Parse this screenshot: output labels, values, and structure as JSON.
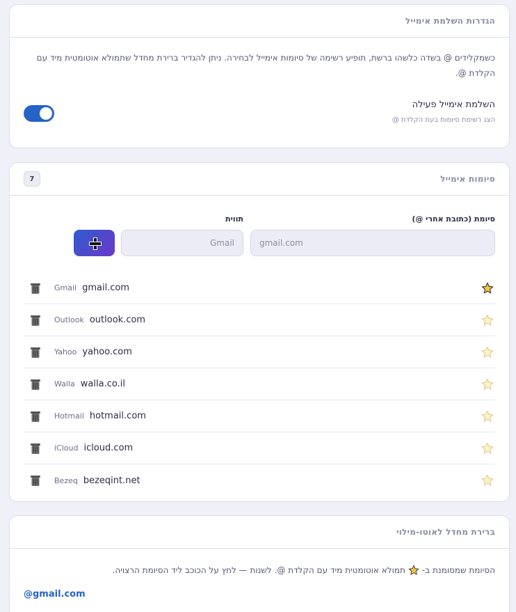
{
  "settings": {
    "title": "הגדרות השלמת אימייל",
    "description": "כשמקלידים @ בשדה כלשהו ברשת, תופיע רשימה של סיומות אימייל לבחירה. ניתן להגדיר ברירת מחדל שתמולא אוטומטית מיד עם הקלדת @.",
    "toggle_label": "השלמת אימייל פעילה",
    "toggle_sub": "הצג רשימת סיומות בעת הקלדת @",
    "toggle_on": true,
    "accent_color": "#2563c7"
  },
  "suffixes": {
    "title": "סיומות אימייל",
    "count": "7",
    "suffix_label": "סיומת (כתובת אחרי @)",
    "suffix_placeholder": "gmail.com",
    "name_label": "תווית",
    "name_placeholder": "Gmail",
    "add_icon": "plus-icon",
    "items": [
      {
        "label": "Gmail",
        "domain": "gmail.com",
        "default": true
      },
      {
        "label": "Outlook",
        "domain": "outlook.com",
        "default": false
      },
      {
        "label": "Yahoo",
        "domain": "yahoo.com",
        "default": false
      },
      {
        "label": "Walla",
        "domain": "walla.co.il",
        "default": false
      },
      {
        "label": "Hotmail",
        "domain": "hotmail.com",
        "default": false
      },
      {
        "label": "iCloud",
        "domain": "icloud.com",
        "default": false
      },
      {
        "label": "Bezeq",
        "domain": "bezeqint.net",
        "default": false
      }
    ]
  },
  "default_card": {
    "title": "ברירת מחדל לאוטו-מילוי",
    "desc_before": "הסיומת שמסומנת ב-",
    "desc_after": " תמולא אוטומטית מיד עם הקלדת @. לשנות — לחץ על הכוכב ליד הסיומת הרצויה.",
    "value": "@gmail.com"
  }
}
